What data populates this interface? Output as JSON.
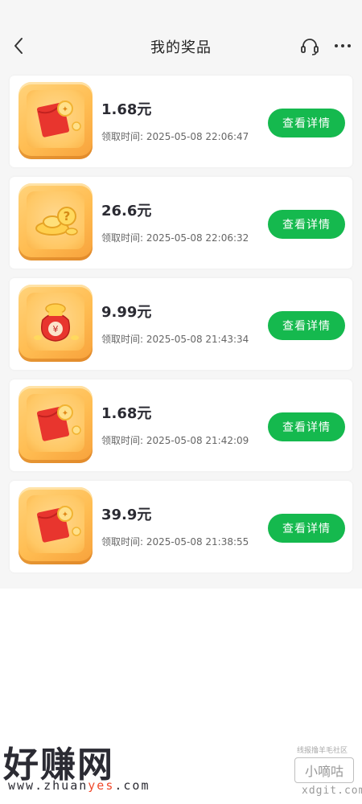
{
  "header": {
    "title": "我的奖品",
    "back_icon": "chevron-left-icon",
    "service_icon": "headset-icon",
    "more_icon": "more-horizontal-icon"
  },
  "prizes": [
    {
      "amount": "1.68元",
      "time": "领取时间: 2025-05-08 22:06:47",
      "button": "查看详情",
      "image": "red-envelope-coin-icon"
    },
    {
      "amount": "26.6元",
      "time": "领取时间: 2025-05-08 22:06:32",
      "button": "查看详情",
      "image": "gold-ingot-question-icon"
    },
    {
      "amount": "9.99元",
      "time": "领取时间: 2025-05-08 21:43:34",
      "button": "查看详情",
      "image": "money-bag-icon"
    },
    {
      "amount": "1.68元",
      "time": "领取时间: 2025-05-08 21:42:09",
      "button": "查看详情",
      "image": "red-envelope-coin-icon"
    },
    {
      "amount": "39.9元",
      "time": "领取时间: 2025-05-08 21:38:55",
      "button": "查看详情",
      "image": "red-envelope-coin-icon"
    }
  ],
  "watermark": {
    "site_name": "好赚网",
    "url_prefix": "www.zhuan",
    "url_highlight": "yes",
    "url_suffix": ".com",
    "right_top": "线报撸羊毛社区",
    "right_name": "小嘀咕",
    "right_url": "xdgit.com"
  },
  "colors": {
    "accent_green": "#15b94e",
    "thumb_orange": "#ffbd52",
    "envelope_red": "#e8352e"
  }
}
